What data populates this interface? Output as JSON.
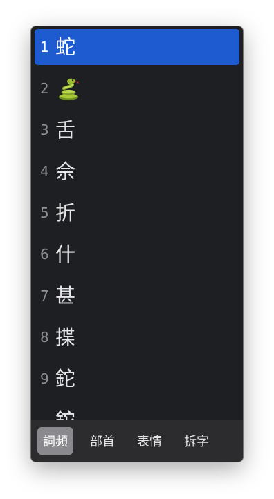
{
  "candidates": [
    {
      "index": "1",
      "text": "蛇",
      "selected": true
    },
    {
      "index": "2",
      "emoji": "snake-emoji"
    },
    {
      "index": "3",
      "text": "舌"
    },
    {
      "index": "4",
      "text": "佘"
    },
    {
      "index": "5",
      "text": "折"
    },
    {
      "index": "6",
      "text": "什"
    },
    {
      "index": "7",
      "text": "甚"
    },
    {
      "index": "8",
      "text": "揲"
    },
    {
      "index": "9",
      "text": "鉈"
    },
    {
      "index": "",
      "text": "鉈"
    }
  ],
  "tabs": [
    {
      "label": "詞頻",
      "active": true
    },
    {
      "label": "部首"
    },
    {
      "label": "表情"
    },
    {
      "label": "拆字"
    }
  ],
  "colors": {
    "panel_background": "#1e1f22",
    "selection": "#1f5bd0",
    "tab_bar": "#2c2c2e",
    "active_tab": "#8a8a8e",
    "index_number": "#8e8e93",
    "candidate_text": "#e6e6e8"
  }
}
